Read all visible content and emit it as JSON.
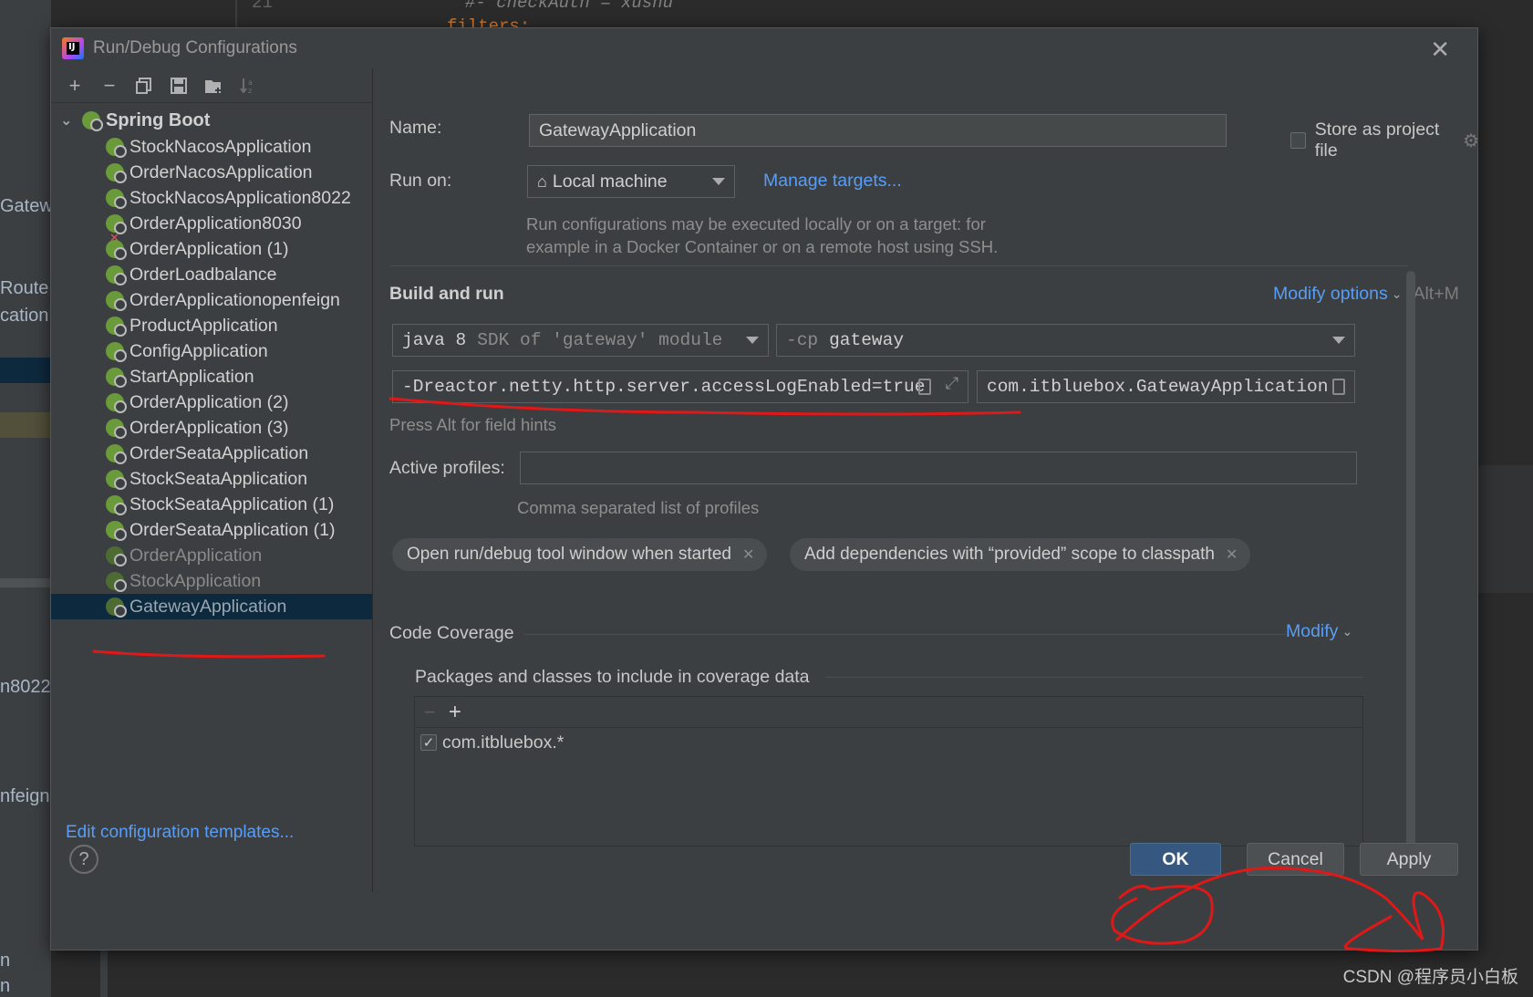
{
  "background": {
    "line_number": "21",
    "code_line_1": "#- checkAuth = xushu",
    "code_line_2": "filters:",
    "left_labels": [
      "Gatewa",
      "RouteP",
      "cation",
      "n8022",
      "nfeign",
      "n",
      "n"
    ]
  },
  "dialog": {
    "title": "Run/Debug Configurations",
    "close_icon": "close-icon"
  },
  "toolbar": {
    "icons": [
      "plus-icon",
      "minus-icon",
      "copy-icon",
      "save-icon",
      "new-folder-icon",
      "sort-icon"
    ]
  },
  "tree": {
    "root_label": "Spring Boot",
    "items": [
      {
        "label": "StockNacosApplication",
        "state": "normal"
      },
      {
        "label": "OrderNacosApplication",
        "state": "normal"
      },
      {
        "label": "StockNacosApplication8022",
        "state": "normal"
      },
      {
        "label": "OrderApplication8030",
        "state": "normal"
      },
      {
        "label": "OrderApplication (1)",
        "state": "error"
      },
      {
        "label": "OrderLoadbalance",
        "state": "normal"
      },
      {
        "label": "OrderApplicationopenfeign",
        "state": "normal"
      },
      {
        "label": "ProductApplication",
        "state": "normal"
      },
      {
        "label": "ConfigApplication",
        "state": "normal"
      },
      {
        "label": "StartApplication",
        "state": "normal"
      },
      {
        "label": "OrderApplication (2)",
        "state": "normal"
      },
      {
        "label": "OrderApplication (3)",
        "state": "normal"
      },
      {
        "label": "OrderSeataApplication",
        "state": "normal"
      },
      {
        "label": "StockSeataApplication",
        "state": "normal"
      },
      {
        "label": "StockSeataApplication (1)",
        "state": "normal"
      },
      {
        "label": "OrderSeataApplication (1)",
        "state": "normal"
      },
      {
        "label": "OrderApplication",
        "state": "dim"
      },
      {
        "label": "StockApplication",
        "state": "dim"
      },
      {
        "label": "GatewayApplication",
        "state": "selected"
      }
    ],
    "edit_templates_link": "Edit configuration templates..."
  },
  "form": {
    "name_label": "Name:",
    "name_value": "GatewayApplication",
    "store_label": "Store as project file",
    "run_on_label": "Run on:",
    "run_on_value": "Local machine",
    "manage_targets": "Manage targets...",
    "run_hint_1": "Run configurations may be executed locally or on a target: for",
    "run_hint_2": "example in a Docker Container or on a remote host using SSH.",
    "build_run_title": "Build and run",
    "modify_options": "Modify options",
    "modify_shortcut": "Alt+M",
    "jdk_main": "java 8",
    "jdk_sub": "SDK of 'gateway' module",
    "cp_flag": "-cp",
    "cp_value": "gateway",
    "vm_options": "-Dreactor.netty.http.server.accessLogEnabled=true",
    "main_class": "com.itbluebox.GatewayApplication",
    "field_hint": "Press Alt for field hints",
    "profiles_label": "Active profiles:",
    "profiles_value": "",
    "profiles_hint": "Comma separated list of profiles",
    "chips": [
      "Open run/debug tool window when started",
      "Add dependencies with “provided” scope to classpath"
    ],
    "coverage_title": "Code Coverage",
    "coverage_modify": "Modify",
    "coverage_subtitle": "Packages and classes to include in coverage data",
    "coverage_entry": "com.itbluebox.*",
    "coverage_entry_checked": true
  },
  "buttons": {
    "help": "?",
    "ok": "OK",
    "cancel": "Cancel",
    "apply": "Apply"
  },
  "watermark": "CSDN @程序员小白板",
  "colors": {
    "accent_link": "#589df6",
    "primary_button": "#365880",
    "selection": "#0d293e",
    "annotation": "#e01818"
  }
}
